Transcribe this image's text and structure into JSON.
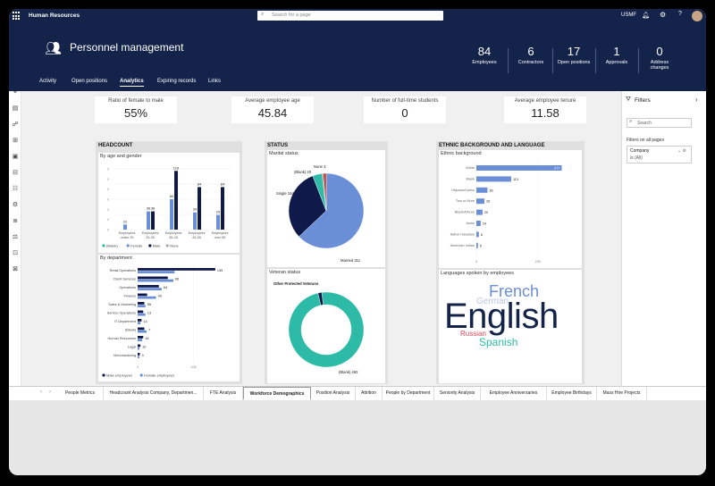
{
  "app": {
    "title": "Human Resources",
    "search_placeholder": "Search for a page",
    "company": "USMF"
  },
  "page": {
    "title": "Personnel management"
  },
  "stats": [
    {
      "value": "84",
      "label": "Employees"
    },
    {
      "value": "6",
      "label": "Contractors"
    },
    {
      "value": "17",
      "label": "Open positions"
    },
    {
      "value": "1",
      "label": "Approvals"
    },
    {
      "value": "0",
      "label": "Address changes"
    }
  ],
  "tabs": [
    "Activity",
    "Open positions",
    "Analytics",
    "Expiring records",
    "Links"
  ],
  "active_tab": "Analytics",
  "kpis": [
    {
      "label": "Ratio of female to male",
      "value": "55%"
    },
    {
      "label": "Average employee age",
      "value": "45.84"
    },
    {
      "label": "Number of full-time students",
      "value": "0"
    },
    {
      "label": "Average employee tenure",
      "value": "11.58"
    }
  ],
  "headcount": {
    "title": "HEADCOUNT",
    "age_title": "By age and gender",
    "dept_title": "By department",
    "age_legend": [
      "(Blank)",
      "Female",
      "Male",
      "None"
    ],
    "dept_legend": [
      "Male employees",
      "Female employees"
    ]
  },
  "status": {
    "title": "STATUS",
    "marital_title": "Marital status",
    "veteran_title": "Veteran status"
  },
  "ethnic": {
    "title": "ETHNIC BACKGROUND AND LANGUAGE",
    "bg_title": "Ethnic background",
    "lang_title": "Languages spoken by employees"
  },
  "wordcloud": [
    {
      "word": "English",
      "color": "#13234a"
    },
    {
      "word": "French",
      "color": "#6b8fd6"
    },
    {
      "word": "German",
      "color": "#b8c8e8"
    },
    {
      "word": "Russian",
      "color": "#e0465a"
    },
    {
      "word": "Spanish",
      "color": "#2dbba8"
    }
  ],
  "filters": {
    "title": "Filters",
    "search_placeholder": "Search",
    "section": "Filters on all pages",
    "item": "Company",
    "item_value": "is (All)"
  },
  "bottom_tabs": [
    "People Metrics",
    "Headcount Analysis Company, Departmen...",
    "FTE Analysis",
    "Workforce Demographics",
    "Position Analysis",
    "Attrition",
    "People by Department",
    "Seniority Analysis",
    "Employee Anniversaries",
    "Employee Birthdays",
    "Mass Hire Projects"
  ],
  "active_bottom_tab": "Workforce Demographics",
  "colors": {
    "navy": "#13234a",
    "dark": "#0f1a4a",
    "blue": "#6b8fd6",
    "teal": "#2dbba8",
    "light": "#b8c8e8"
  },
  "chart_data": [
    {
      "type": "bar",
      "title": "By age and gender",
      "categories": [
        "Employees under 25",
        "Employees 25-35",
        "Employees 35-45",
        "Employees 45-55",
        "Employees over 55"
      ],
      "series": [
        {
          "name": "(Blank)",
          "values": [
            0,
            0,
            0,
            0,
            0
          ]
        },
        {
          "name": "Female",
          "values": [
            10,
            36,
            60,
            34,
            29
          ]
        },
        {
          "name": "Male",
          "values": [
            0,
            36,
            116,
            84,
            84
          ]
        },
        {
          "name": "None",
          "values": [
            0,
            0,
            0,
            0,
            0
          ]
        }
      ],
      "data_labels": [
        [
          "10"
        ],
        [
          "36",
          "36"
        ],
        [
          "60",
          "116"
        ],
        [
          "34",
          "84"
        ],
        [
          "29",
          "84"
        ]
      ],
      "ylim": [
        0,
        120
      ]
    },
    {
      "type": "bar",
      "title": "By department",
      "orientation": "horizontal",
      "categories": [
        "Retail Operations",
        "Client Services",
        "Operations",
        "Finance",
        "Sales & Marketing",
        "Service Operations",
        "IT Department",
        "(Blank)",
        "Human Resources",
        "Legal",
        "Merchandising"
      ],
      "series": [
        {
          "name": "Male employees",
          "values": [
            139,
            54,
            38,
            17,
            12,
            10,
            7,
            12,
            10,
            5,
            4
          ]
        },
        {
          "name": "Female employees",
          "values": [
            66,
            64,
            43,
            33,
            14,
            14,
            5,
            16,
            8,
            3,
            3
          ]
        }
      ],
      "label_values": [
        139,
        66,
        64,
        43,
        55,
        13,
        14,
        7,
        16,
        10,
        3
      ],
      "xticks": [
        "0",
        "100"
      ]
    },
    {
      "type": "pie",
      "title": "Marital status",
      "labels": [
        "Married",
        "Single",
        "(Blank)",
        "None",
        "Other"
      ],
      "values": [
        311,
        154,
        20,
        3,
        6
      ],
      "shown_labels": [
        "Married 311",
        "Single 154",
        "(Blank) 20",
        "None 3"
      ]
    },
    {
      "type": "pie",
      "title": "Veteran status",
      "labels": [
        "(Blank)",
        "Other Protected Veterans"
      ],
      "values": [
        492,
        8
      ],
      "shown_labels": [
        "(Blank) 492",
        "Other Protected Veterans"
      ]
    },
    {
      "type": "bar",
      "title": "Ethnic background",
      "orientation": "horizontal",
      "categories": [
        "White",
        "Blank",
        "Hispanic/Latino",
        "Two or More",
        "Black/African",
        "Asian",
        "Native Hawaiian",
        "American Indian"
      ],
      "values": [
        277,
        113,
        36,
        26,
        20,
        14,
        8,
        5
      ],
      "xticks": [
        "0",
        "200"
      ]
    }
  ]
}
